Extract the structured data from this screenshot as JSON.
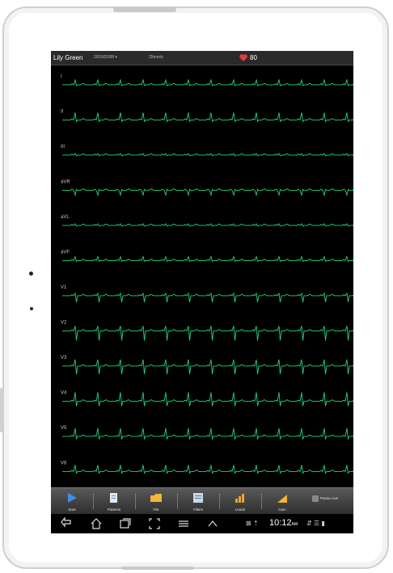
{
  "patient": {
    "name": "Lily Green",
    "date": "2010/02/08 ▾",
    "speed": "25mm/s"
  },
  "heart_rate": "80",
  "colors": {
    "trace": "#1fd67a",
    "heart": "#e23b3b",
    "screen_bg": "#000000"
  },
  "leads": [
    "I",
    "II",
    "III",
    "aVR",
    "aVL",
    "aVF",
    "V1",
    "V2",
    "V3",
    "V4",
    "V5",
    "V6"
  ],
  "toolbar": [
    {
      "label": "Start",
      "icon": "play-icon"
    },
    {
      "label": "Patients",
      "icon": "patients-icon"
    },
    {
      "label": "File",
      "icon": "folder-icon"
    },
    {
      "label": "Filters",
      "icon": "filters-icon"
    },
    {
      "label": "Leads",
      "icon": "bar-chart-icon"
    },
    {
      "label": "Gain",
      "icon": "signal-icon"
    }
  ],
  "pause_label": "Pause Live",
  "navbar": {
    "icons": [
      "back-icon",
      "home-icon",
      "recent-apps-icon",
      "screenshot-icon",
      "menu-icon",
      "up-arrow-icon"
    ],
    "time": "10:12",
    "ampm": "AM"
  }
}
